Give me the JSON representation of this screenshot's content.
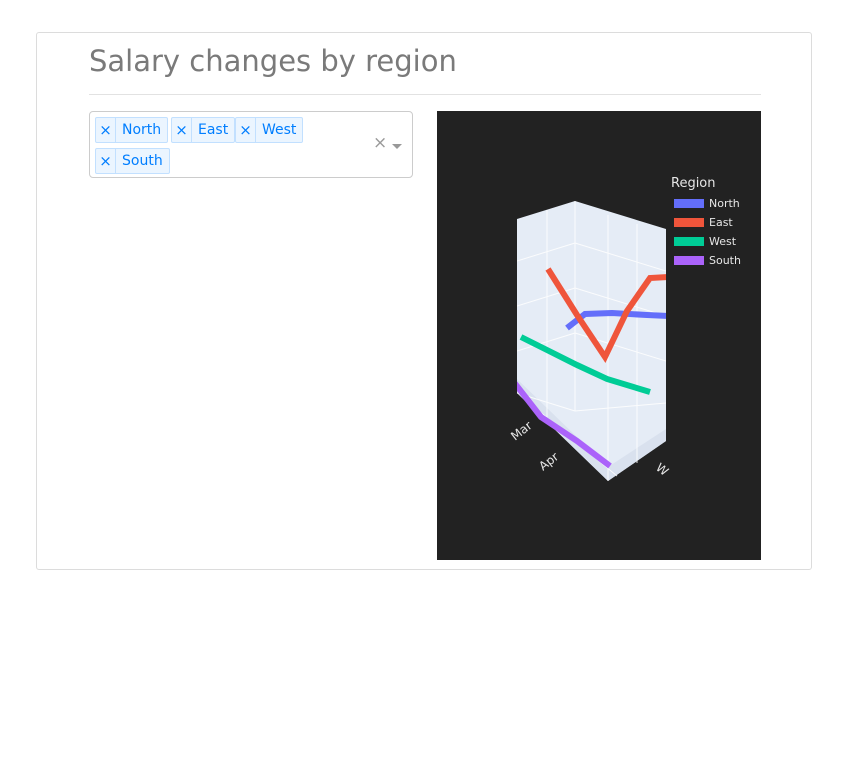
{
  "page": {
    "title": "Salary changes by region"
  },
  "region_select": {
    "remove_glyph": "×",
    "clear_glyph": "×",
    "selected": [
      {
        "label": "North"
      },
      {
        "label": "East"
      },
      {
        "label": "West"
      },
      {
        "label": "South"
      }
    ]
  },
  "chart": {
    "legend_title": "Region",
    "x_tick_labels": [
      "Mar",
      "Apr",
      "W"
    ],
    "series": [
      {
        "name": "North",
        "color": "#636efa"
      },
      {
        "name": "East",
        "color": "#ef553b"
      },
      {
        "name": "West",
        "color": "#00cc96"
      },
      {
        "name": "South",
        "color": "#ab63fa"
      }
    ]
  },
  "chart_data": {
    "type": "line",
    "legend_title": "Region",
    "legend_position": "top-right",
    "series": [
      {
        "name": "North"
      },
      {
        "name": "East"
      },
      {
        "name": "West"
      },
      {
        "name": "South"
      }
    ]
  }
}
